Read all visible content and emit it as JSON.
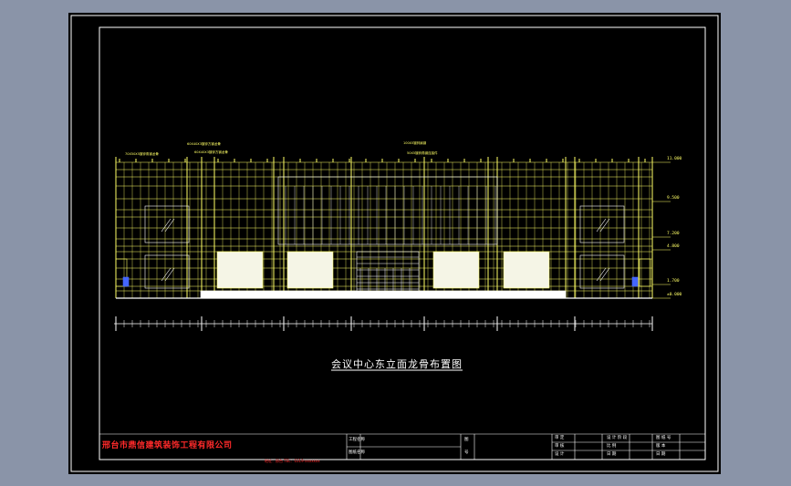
{
  "drawing": {
    "title": "会议中心东立面龙骨布置图",
    "company": "邢台市鼎信建筑装饰工程有限公司",
    "address": "地址：邢台  TEL：0319-xxxxxxx"
  },
  "levels": [
    "11.000",
    "9.500",
    "7.200",
    "4.800",
    "1.700",
    "±0.000"
  ],
  "notes": [
    "70X50X5镀锌角钢龙骨",
    "60X40X3镀锌方钢龙骨",
    "60X40X3镀锌方钢龙骨",
    "100X5镀锌扁钢",
    "50X5镀锌角钢连接件"
  ],
  "title_block": {
    "project": "工程名称",
    "drawing_name": "图纸名称",
    "col2": [
      "图",
      "号"
    ],
    "roles_left": [
      "审 定",
      "审 核",
      "设 计"
    ],
    "roles_mid": [
      "设 计 阶 段",
      "比 例",
      "日 期"
    ],
    "roles_right": [
      "图 纸 号",
      "版 本",
      "日 期"
    ]
  },
  "colors": {
    "background": "#000000",
    "frame": "#ffffff",
    "steel": "#ffff66",
    "glass": "#f5f5e6",
    "company": "#ff2a2a"
  }
}
